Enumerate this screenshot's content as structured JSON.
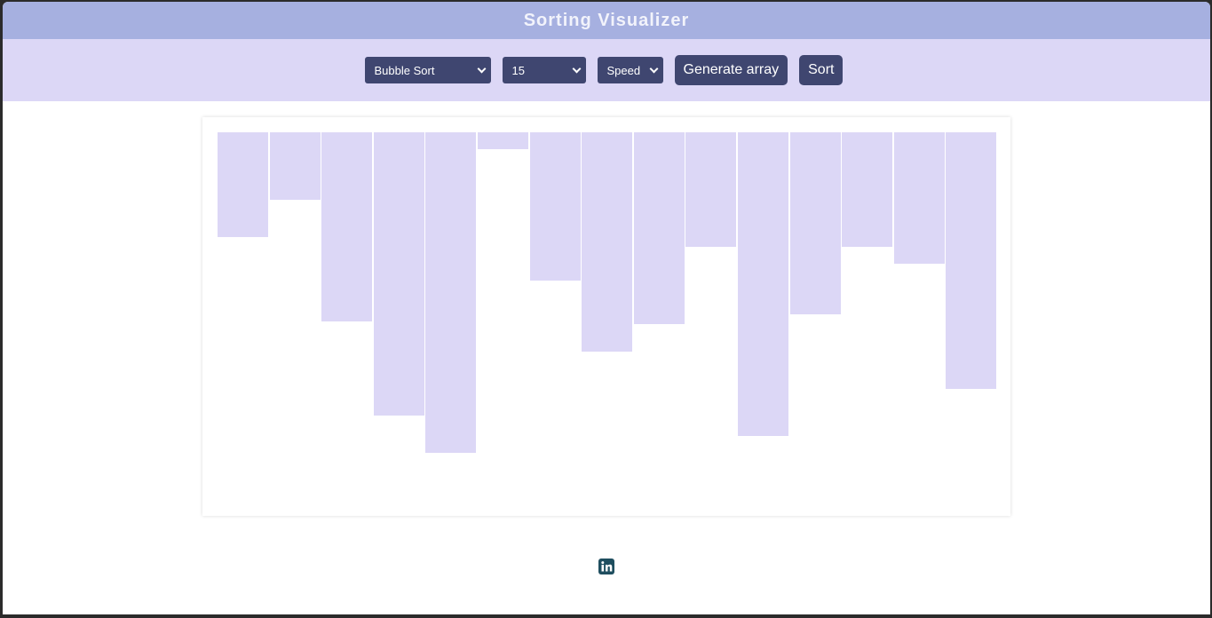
{
  "header": {
    "title": "Sorting Visualizer"
  },
  "controls": {
    "algorithm": {
      "selected": "Bubble Sort"
    },
    "size": {
      "selected": "15"
    },
    "speed": {
      "selected": "Speed"
    },
    "generate_label": "Generate array",
    "sort_label": "Sort"
  },
  "chart_data": {
    "type": "bar",
    "values": [
      118,
      76,
      213,
      319,
      361,
      19,
      167,
      247,
      216,
      129,
      342,
      205,
      129,
      148,
      289
    ],
    "orientation": "top-anchored",
    "color": "#dcd7f6"
  },
  "footer": {
    "icon": "linkedin-icon",
    "icon_color": "#1f4e5f"
  }
}
